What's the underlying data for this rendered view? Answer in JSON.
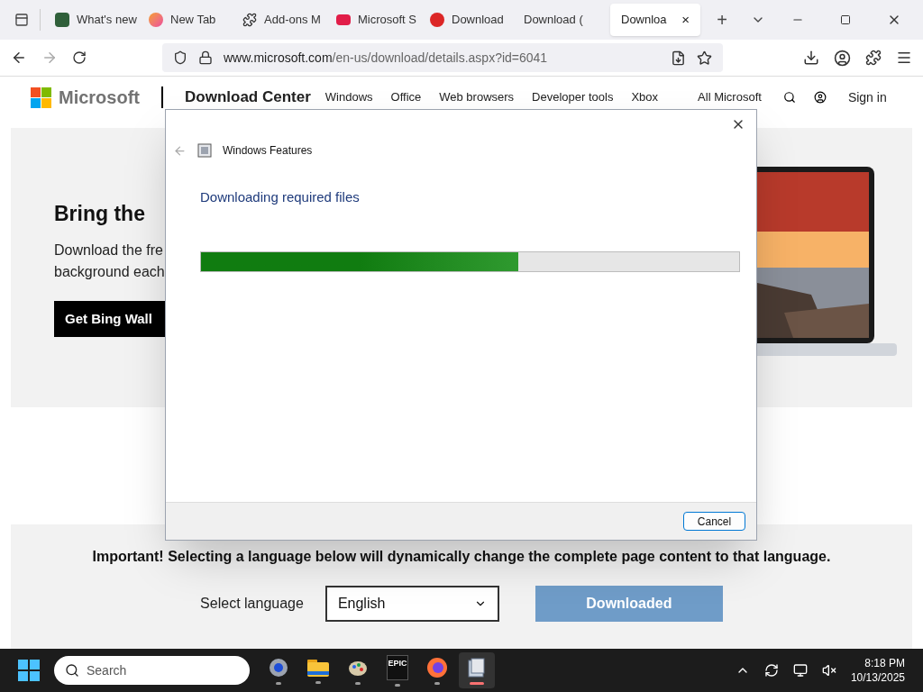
{
  "browser": {
    "tabs": [
      {
        "title": "What's new",
        "selected": false
      },
      {
        "title": "New Tab",
        "selected": false
      },
      {
        "title": "Add-ons M",
        "selected": false
      },
      {
        "title": "Microsoft S",
        "selected": false
      },
      {
        "title": "Download",
        "selected": false
      },
      {
        "title": "Download (",
        "selected": false
      },
      {
        "title": "Downloa",
        "selected": true
      }
    ],
    "close_tab": "×",
    "new_tab": "+",
    "url_host": "www.microsoft.com",
    "url_path": "/en-us/download/details.aspx?id=6041"
  },
  "site": {
    "brand": "Microsoft",
    "section": "Download Center",
    "nav": [
      "Windows",
      "Office",
      "Web browsers",
      "Developer tools",
      "Xbox"
    ],
    "all_microsoft": "All Microsoft",
    "sign_in": "Sign in",
    "hero": {
      "title": "Bring the",
      "lines": [
        "Download the fre",
        "background each"
      ],
      "button": "Get Bing Wall"
    },
    "notice": "Important! Selecting a language below will dynamically change the complete page content to that language.",
    "language_label": "Select language",
    "language_value": "English",
    "download_button": "Downloaded"
  },
  "dialog": {
    "title": "Windows Features",
    "heading": "Downloading required files",
    "progress": {
      "level": 0.59
    },
    "cancel": "Cancel"
  },
  "taskbar": {
    "search_placeholder": "Search",
    "apps": [
      {
        "kind": "settings",
        "active": false
      },
      {
        "kind": "folder",
        "active": false
      },
      {
        "kind": "paint",
        "active": false
      },
      {
        "kind": "epic",
        "label": "EPIC",
        "active": false
      },
      {
        "kind": "firefox",
        "active": false
      },
      {
        "kind": "installer",
        "active": true
      }
    ],
    "time": "8:18 PM",
    "date": "10/13/2025"
  }
}
